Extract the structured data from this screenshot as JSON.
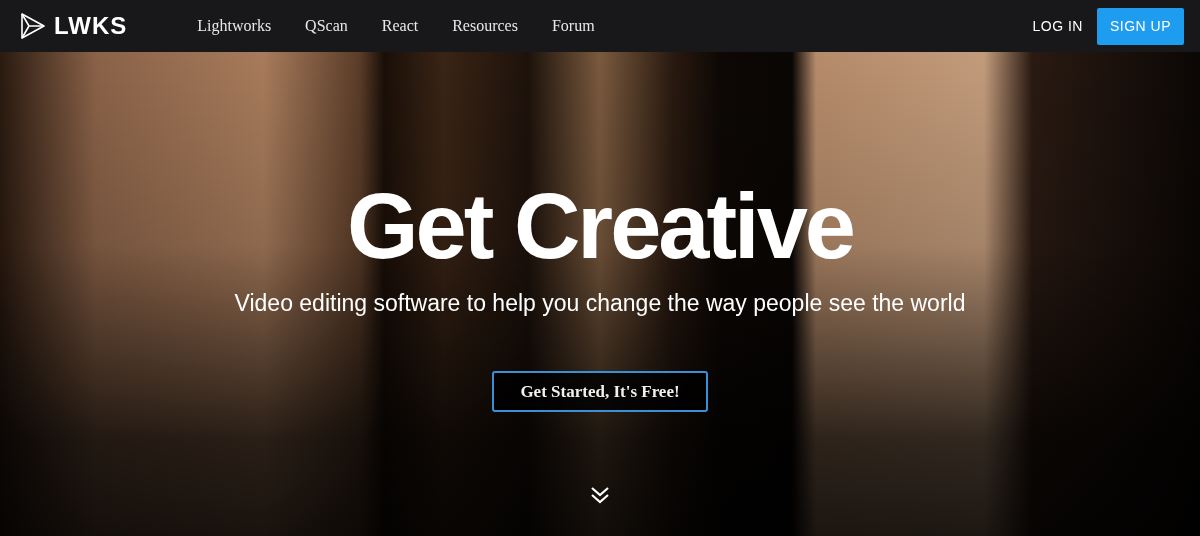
{
  "navbar": {
    "logo": "LWKS",
    "links": [
      {
        "label": "Lightworks"
      },
      {
        "label": "QScan"
      },
      {
        "label": "React"
      },
      {
        "label": "Resources"
      },
      {
        "label": "Forum"
      }
    ],
    "login": "LOG IN",
    "signup": "SIGN UP"
  },
  "hero": {
    "title": "Get Creative",
    "subtitle": "Video editing software to help you change the way people see the world",
    "cta": "Get Started, It's Free!"
  }
}
